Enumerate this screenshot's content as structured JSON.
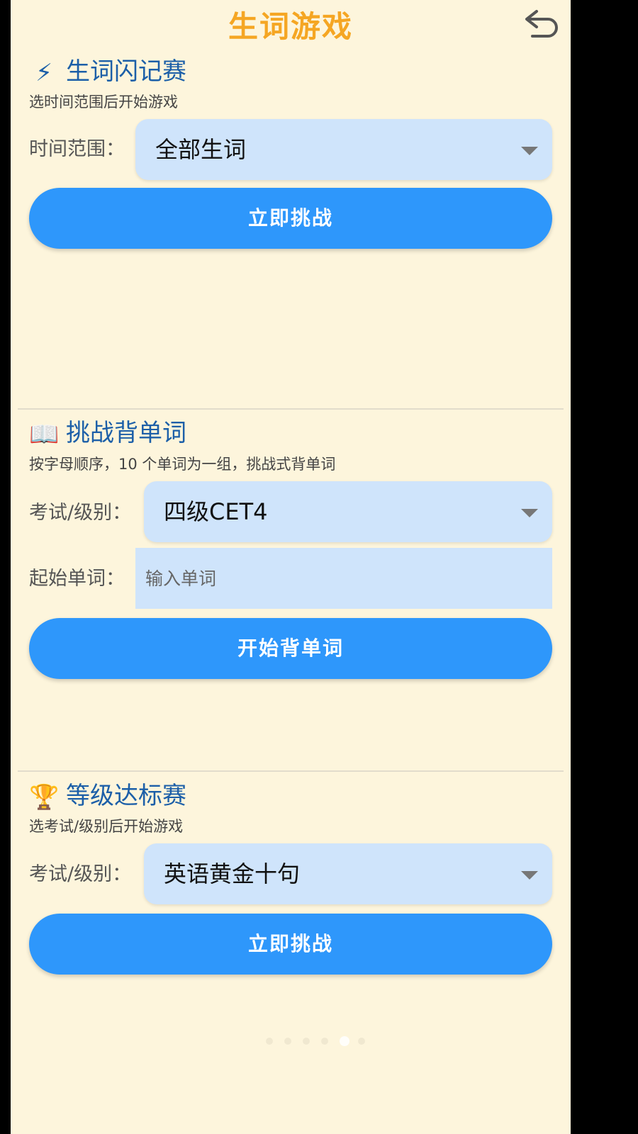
{
  "header": {
    "title": "生词游戏",
    "back_icon": "undo-arrow-icon"
  },
  "sections": [
    {
      "icon": "⚡",
      "title": "生词闪记赛",
      "description": "选时间范围后开始游戏",
      "field_label": "时间范围：",
      "select_value": "全部生词",
      "button_label": "立即挑战"
    },
    {
      "icon": "📖",
      "title": "挑战背单词",
      "description": "按字母顺序，10 个单词为一组，挑战式背单词",
      "field_label": "考试/级别：",
      "select_value": "四级CET4",
      "input_label": "起始单词：",
      "input_placeholder": "输入单词",
      "input_value": "",
      "button_label": "开始背单词"
    },
    {
      "icon": "🏆",
      "title": "等级达标赛",
      "description": "选考试/级别后开始游戏",
      "field_label": "考试/级别：",
      "select_value": "英语黄金十句",
      "button_label": "立即挑战"
    }
  ],
  "pager": {
    "count": 6,
    "active_index": 4
  },
  "colors": {
    "background": "#fdf5dc",
    "title": "#f5a623",
    "section_title": "#1c5fa8",
    "select_bg": "#cfe4fb",
    "button": "#2e97fb"
  }
}
